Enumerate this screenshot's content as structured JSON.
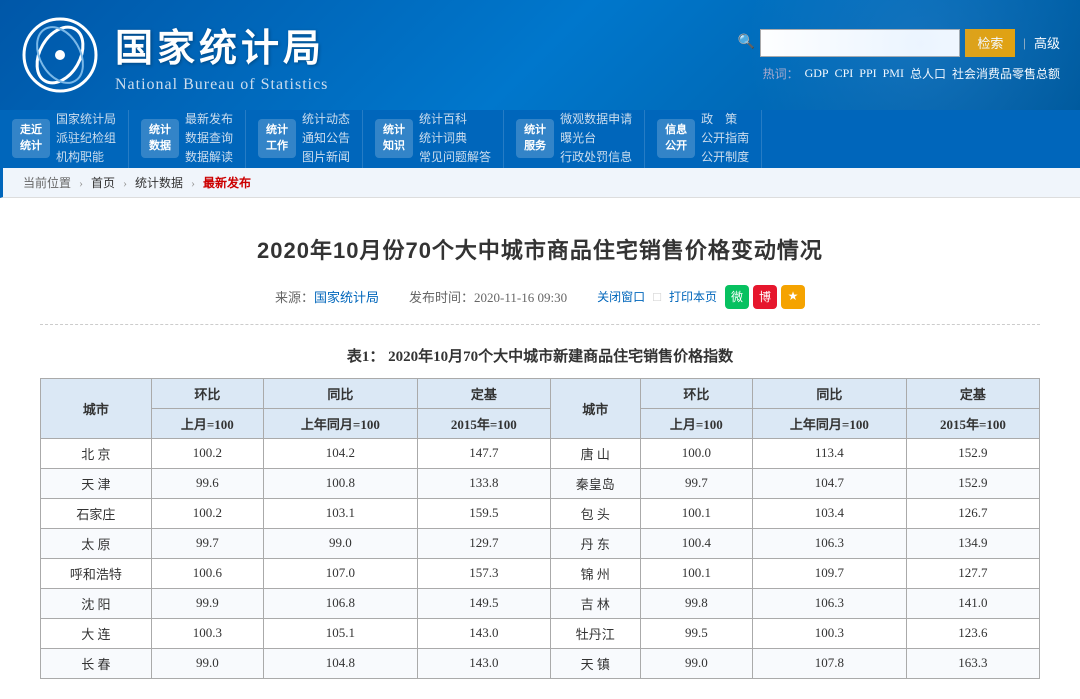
{
  "header": {
    "title": "国家统计局",
    "subtitle": "National Bureau of Statistics",
    "search_placeholder": "",
    "search_btn": "检索",
    "advanced_btn": "高级",
    "hot_label": "热词：",
    "hot_keywords": [
      "GDP",
      "CPI",
      "PPI",
      "PMI",
      "总人口",
      "社会消费品零售总额"
    ]
  },
  "nav": {
    "items": [
      {
        "icon": "走近\n统计",
        "links": [
          "国家统计局",
          "派驻纪检组",
          "机构职能"
        ]
      },
      {
        "icon": "统计\n数据",
        "links": [
          "最新发布",
          "数据查询",
          "数据解读"
        ]
      },
      {
        "icon": "统计\n工作",
        "links": [
          "统计动态",
          "通知公告",
          "图片新闻"
        ]
      },
      {
        "icon": "统计\n知识",
        "links": [
          "统计百科",
          "统计词典",
          "常见问题解答"
        ]
      },
      {
        "icon": "统计\n服务",
        "links": [
          "微观数据申请",
          "曝光台",
          "行政处罚信息"
        ]
      },
      {
        "icon": "信息\n公开",
        "links": [
          "政  策",
          "公开指南",
          "公开制度"
        ]
      }
    ]
  },
  "breadcrumb": {
    "items": [
      "当前位置",
      "首页",
      "统计数据",
      "最新发布"
    ]
  },
  "article": {
    "title": "2020年10月份70个大中城市商品住宅销售价格变动情况",
    "source_label": "来源：",
    "source_name": "国家统计局",
    "publish_label": "发布时间：",
    "publish_time": "2020-11-16 09:30",
    "close_btn": "关闭窗口",
    "print_btn": "打印本页"
  },
  "table1": {
    "title": "表1：  2020年10月70个大中城市新建商品住宅销售价格指数",
    "headers": {
      "city": "城市",
      "huan_bi": "环比",
      "huan_bi_sub": "上月=100",
      "tong_bi": "同比",
      "tong_bi_sub": "上年同月=100",
      "ding_ji": "定基",
      "ding_ji_sub": "2015年=100"
    },
    "rows_left": [
      {
        "city": "北  京",
        "hb": "100.2",
        "tb": "104.2",
        "dj": "147.7"
      },
      {
        "city": "天  津",
        "hb": "99.6",
        "tb": "100.8",
        "dj": "133.8"
      },
      {
        "city": "石家庄",
        "hb": "100.2",
        "tb": "103.1",
        "dj": "159.5"
      },
      {
        "city": "太  原",
        "hb": "99.7",
        "tb": "99.0",
        "dj": "129.7"
      },
      {
        "city": "呼和浩特",
        "hb": "100.6",
        "tb": "107.0",
        "dj": "157.3"
      },
      {
        "city": "沈  阳",
        "hb": "99.9",
        "tb": "106.8",
        "dj": "149.5"
      },
      {
        "city": "大  连",
        "hb": "100.3",
        "tb": "105.1",
        "dj": "143.0"
      },
      {
        "city": "长  春",
        "hb": "99.0",
        "tb": "104.8",
        "dj": "143.0"
      }
    ],
    "rows_right": [
      {
        "city": "唐  山",
        "hb": "100.0",
        "tb": "113.4",
        "dj": "152.9"
      },
      {
        "city": "秦皇岛",
        "hb": "99.7",
        "tb": "104.7",
        "dj": "152.9"
      },
      {
        "city": "包  头",
        "hb": "100.1",
        "tb": "103.4",
        "dj": "126.7"
      },
      {
        "city": "丹  东",
        "hb": "100.4",
        "tb": "106.3",
        "dj": "134.9"
      },
      {
        "city": "锦  州",
        "hb": "100.1",
        "tb": "109.7",
        "dj": "127.7"
      },
      {
        "city": "吉  林",
        "hb": "99.8",
        "tb": "106.3",
        "dj": "141.0"
      },
      {
        "city": "牡丹江",
        "hb": "99.5",
        "tb": "100.3",
        "dj": "123.6"
      },
      {
        "city": "天  镇",
        "hb": "99.0",
        "tb": "107.8",
        "dj": "163.3"
      }
    ]
  }
}
